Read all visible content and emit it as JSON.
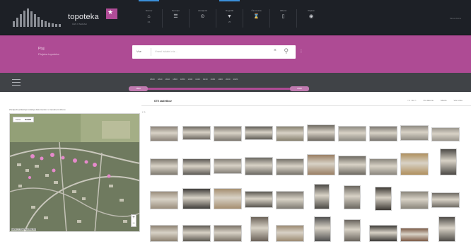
{
  "app": {
    "name": "topoteka",
    "tagline": "ČAS V SLIKAH"
  },
  "nav": [
    {
      "label": "Domov",
      "icon": "home-icon",
      "glyph": "⌂",
      "sub": "1/1",
      "active": true
    },
    {
      "label": "Seznam",
      "icon": "list-icon",
      "glyph": "☰",
      "sub": "",
      "active": false
    },
    {
      "label": "Zemljevid",
      "icon": "map-pin-icon",
      "glyph": "⊙",
      "sub": "",
      "active": false
    },
    {
      "label": "Dogodki",
      "icon": "calendar-icon",
      "glyph": "▼",
      "sub": "25",
      "active": true
    },
    {
      "label": "Časovnica",
      "icon": "timeline-icon",
      "glyph": "⌛",
      "sub": "",
      "active": false
    },
    {
      "label": "Albumi",
      "icon": "album-icon",
      "glyph": "▯",
      "sub": "",
      "active": false
    },
    {
      "label": "Prijava",
      "icon": "user-icon",
      "glyph": "◉",
      "sub": "",
      "active": false
    }
  ],
  "top_right": "Slovenščina",
  "place": {
    "title": "Ptuj",
    "subtitle": "Ptujska topoteka"
  },
  "search": {
    "kind": "Vse",
    "placeholder": "Vnesi iskalni niz...",
    "clear_glyph": "×",
    "search_glyph": "⚲"
  },
  "menu_glyph": "⋮",
  "timeline": {
    "years": [
      "1800",
      "1820",
      "1840",
      "1860",
      "1880",
      "1900",
      "1920",
      "1940",
      "1960",
      "1980",
      "2000",
      "2020"
    ],
    "range_start": "1820",
    "range_end": "2020",
    "start_fraction": 0.0,
    "end_fraction": 1.0
  },
  "results": {
    "count": "675 zadetkov",
    "pager": "< 1 / 12 >",
    "sort": "Po datumu",
    "view": "Mreža",
    "filter": "Vse vrste"
  },
  "map": {
    "caption": "Zemljevid prikazuje lokacije dokumentov v trenutnem izboru",
    "toggle": [
      "Karta",
      "Satelit"
    ],
    "zoom_in": "+",
    "zoom_out": "−",
    "attribution": "Leaflet | © OpenStreetMap, Esri"
  },
  "collapse_glyph": "‹ ›",
  "colors": {
    "topbar": "#1d2026",
    "band": "#ae4b94",
    "timeline": "#404347",
    "accent": "#3b8fd9"
  },
  "thumbnails": [
    {
      "tone": "#8a8278"
    },
    {
      "tone": "#6b6760"
    },
    {
      "tone": "#7c776f"
    },
    {
      "tone": "#5f5c56"
    },
    {
      "tone": "#86806f"
    },
    {
      "tone": "#6f6a62"
    },
    {
      "tone": "#8d8a82"
    },
    {
      "tone": "#7a7670"
    },
    {
      "tone": "#908c84"
    },
    {
      "tone": "#9a968e"
    },
    {
      "tone": "#7f7a70"
    },
    {
      "tone": "#5d5a55"
    },
    {
      "tone": "#858078"
    },
    {
      "tone": "#6c6963"
    },
    {
      "tone": "#77736b"
    },
    {
      "tone": "#9a7f64"
    },
    {
      "tone": "#6e6a62"
    },
    {
      "tone": "#8b877e"
    },
    {
      "tone": "#b0905e"
    },
    {
      "tone": "#4c4a46"
    },
    {
      "tone": "#9a8d7c"
    },
    {
      "tone": "#3f3d3a"
    },
    {
      "tone": "#a58e70"
    },
    {
      "tone": "#5a5751"
    },
    {
      "tone": "#7e7a72"
    },
    {
      "tone": "#4b4945"
    },
    {
      "tone": "#6a665f"
    },
    {
      "tone": "#3e3a35"
    },
    {
      "tone": "#8a857b"
    },
    {
      "tone": "#6f6b64"
    },
    {
      "tone": "#8d8272"
    },
    {
      "tone": "#5e5a53"
    },
    {
      "tone": "#7a7267"
    },
    {
      "tone": "#6b6259"
    },
    {
      "tone": "#9c8a72"
    },
    {
      "tone": "#505050"
    },
    {
      "tone": "#6a655e"
    },
    {
      "tone": "#3d3b38"
    },
    {
      "tone": "#7c5b47"
    },
    {
      "tone": "#4f4c48"
    }
  ]
}
